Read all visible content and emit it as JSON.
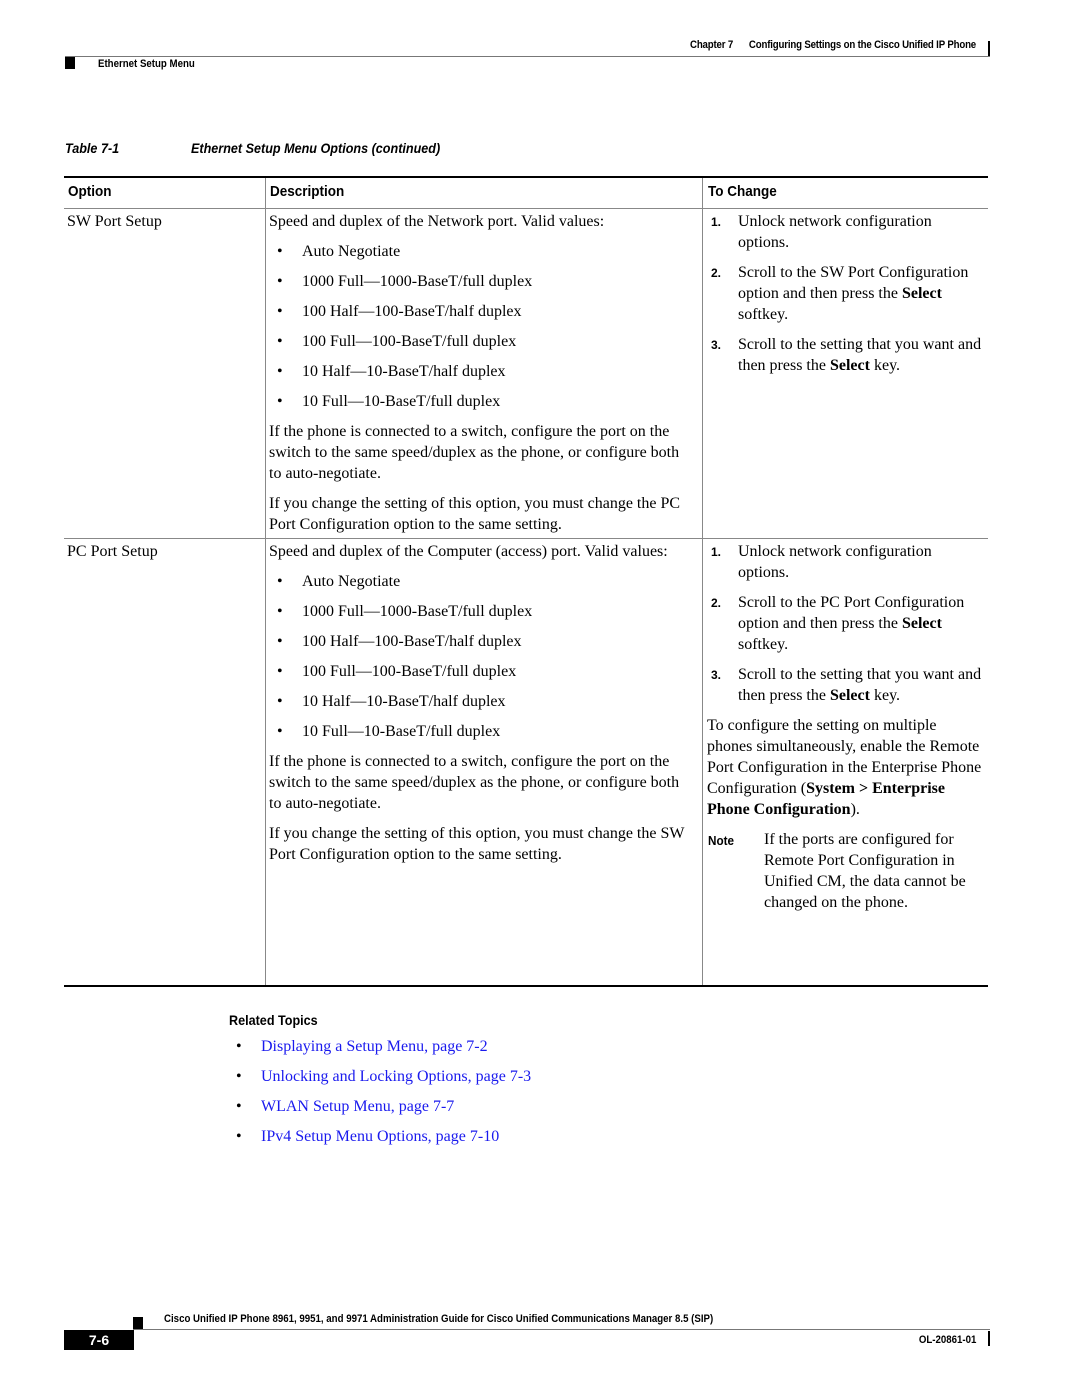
{
  "header": {
    "chapter": "Chapter 7",
    "chapter_title": "Configuring Settings on the Cisco Unified IP Phone",
    "section": "Ethernet Setup Menu"
  },
  "table": {
    "label": "Table 7-1",
    "title": "Ethernet Setup Menu Options (continued)",
    "columns": [
      "Option",
      "Description",
      "To Change"
    ],
    "rows": [
      {
        "option": "SW Port Setup",
        "description_intro": "Speed and duplex of the Network port. Valid values:",
        "values": [
          "Auto Negotiate",
          "1000 Full—1000-BaseT/full duplex",
          "100 Half—100-BaseT/half duplex",
          "100 Full—100-BaseT/full duplex",
          "10 Half—10-BaseT/half duplex",
          "10 Full—10-BaseT/full duplex"
        ],
        "description_p1": "If the phone is connected to a switch, configure the port on the switch to the same speed/duplex as the phone, or configure both to auto-negotiate.",
        "description_p2": "If you change the setting of this option, you must change the PC Port Configuration option to the same setting.",
        "steps": [
          {
            "num": "1.",
            "pre": "Unlock network configuration options.",
            "bold": "",
            "post": ""
          },
          {
            "num": "2.",
            "pre": "Scroll to the SW Port Configuration option and then press the ",
            "bold": "Select",
            "post": " softkey."
          },
          {
            "num": "3.",
            "pre": "Scroll to the setting that you want and then press the ",
            "bold": "Select",
            "post": " key."
          }
        ]
      },
      {
        "option": "PC Port Setup",
        "description_intro": "Speed and duplex of the Computer (access) port. Valid values:",
        "values": [
          "Auto Negotiate",
          "1000 Full—1000-BaseT/full duplex",
          "100 Half—100-BaseT/half duplex",
          "100 Full—100-BaseT/full duplex",
          "10 Half—10-BaseT/half duplex",
          "10 Full—10-BaseT/full duplex"
        ],
        "description_p1": "If the phone is connected to a switch, configure the port on the switch to the same speed/duplex as the phone, or configure both to auto-negotiate.",
        "description_p2": "If you change the setting of this option, you must change the SW Port Configuration option to the same setting.",
        "steps": [
          {
            "num": "1.",
            "pre": "Unlock network configuration options.",
            "bold": "",
            "post": ""
          },
          {
            "num": "2.",
            "pre": "Scroll to the PC Port Configuration option and then press the ",
            "bold": "Select",
            "post": " softkey."
          },
          {
            "num": "3.",
            "pre": "Scroll to the setting that you want and then press the ",
            "bold": "Select",
            "post": " key."
          }
        ],
        "extra_pre": "To configure the setting on multiple phones simultaneously, enable the Remote Port Configuration in the Enterprise Phone Configuration (",
        "extra_bold": "System > Enterprise Phone Configuration",
        "extra_post": ").",
        "note_label": "Note",
        "note_text": "If the ports are configured for Remote Port Configuration in Unified CM, the data cannot be changed on the phone."
      }
    ]
  },
  "related": {
    "title": "Related Topics",
    "bullet": "•",
    "links": [
      "Displaying a Setup Menu, page 7-2",
      "Unlocking and Locking Options, page 7-3",
      "WLAN Setup Menu, page 7-7",
      "IPv4 Setup Menu Options, page 7-10"
    ],
    "link_color": "#1a1aee"
  },
  "footer": {
    "guide_title": "Cisco Unified IP Phone 8961, 9951, and 9971 Administration Guide for Cisco Unified Communications Manager 8.5 (SIP)",
    "page_number": "7-6",
    "doc_number": "OL-20861-01"
  }
}
